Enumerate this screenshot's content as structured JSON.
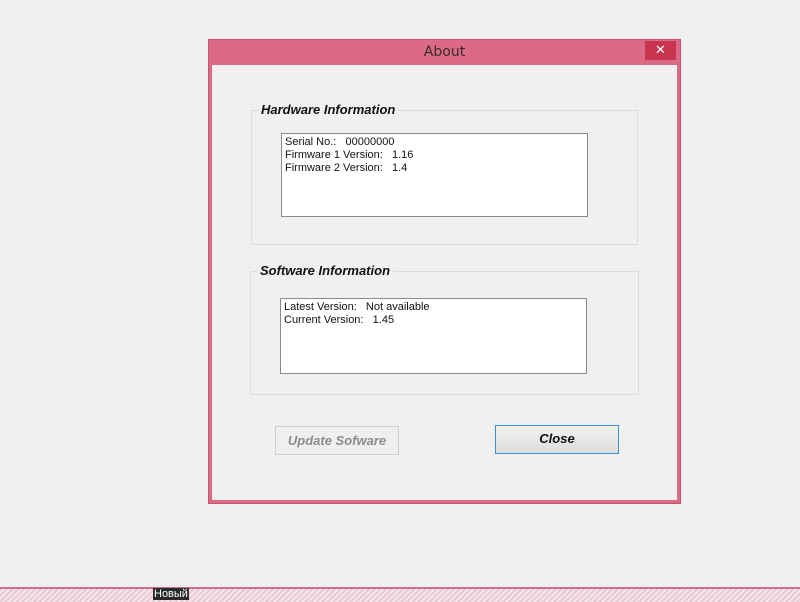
{
  "window": {
    "title": "About",
    "close_glyph": "✕"
  },
  "hardware": {
    "legend": "Hardware Information",
    "lines": [
      "Serial No.:   00000000",
      "Firmware 1 Version:   1.16",
      "Firmware 2 Version:   1.4"
    ]
  },
  "software": {
    "legend": "Software Information",
    "lines": [
      "Latest Version:   Not available",
      "Current Version:   1.45"
    ]
  },
  "buttons": {
    "update_label": "Update Sofware",
    "close_label": "Close"
  },
  "taskbar": {
    "label": "Новый"
  },
  "colors": {
    "frame": "#db6b85",
    "close_button": "#c9344e",
    "focus_border": "#3c8fd9"
  }
}
